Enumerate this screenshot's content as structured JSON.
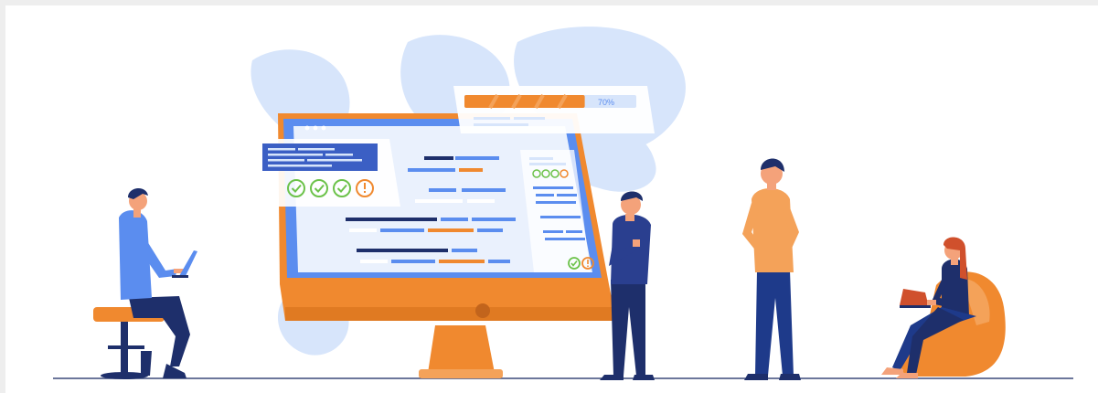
{
  "illustration": {
    "progress": {
      "label": "70%",
      "value": 0.7
    },
    "colors": {
      "blue_primary": "#5b8def",
      "blue_dark": "#1f3a8a",
      "navy": "#1e2f6b",
      "orange": "#f0892f",
      "orange_light": "#f4a259",
      "leaf": "#d7e5fb",
      "screen": "#eaf1fd",
      "check_green": "#6cc24a",
      "warn_orange": "#f0892f"
    },
    "icons": [
      "check-circle-icon",
      "check-circle-icon",
      "check-circle-icon",
      "warning-circle-icon"
    ]
  }
}
